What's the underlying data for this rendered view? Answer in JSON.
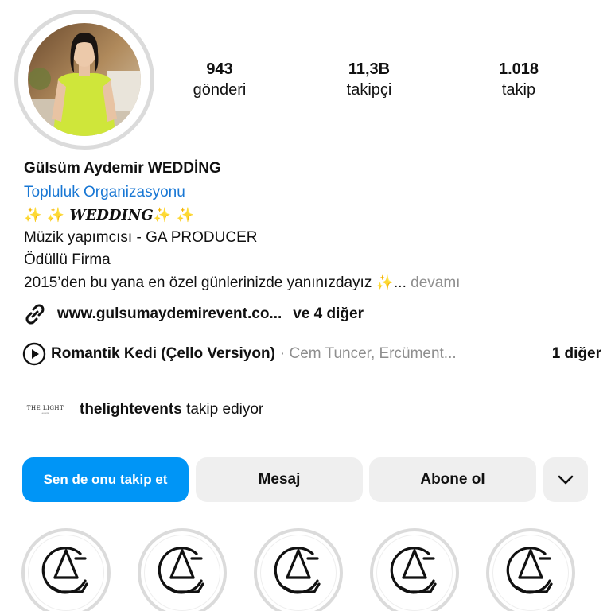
{
  "profile": {
    "avatar_icon": "profile-photo"
  },
  "stats": [
    {
      "value": "943",
      "label": "gönderi"
    },
    {
      "value": "11,3B",
      "label": "takipçi"
    },
    {
      "value": "1.018",
      "label": "takip"
    }
  ],
  "bio": {
    "name": "Gülsüm Aydemir WEDDİNG",
    "category": "Topluluk Organizasyonu",
    "wedding_sparkles_left": "✨ ✨ ",
    "wedding_text": "WEDDING",
    "wedding_sparkles_right": "✨ ✨",
    "line_music": "Müzik yapımcısı  - GA PRODUCER",
    "line_award": "Ödüllü  Firma",
    "line_since": "2015’den bu yana en özel günlerinizde yanınızdayız ",
    "since_sparkle": "✨",
    "ellipsis": "...",
    "more_label": "devamı"
  },
  "link": {
    "url": "www.gulsumaydemirevent.co...",
    "extra": "ve 4 diğer",
    "icon": "link-icon"
  },
  "music": {
    "title": "Romantik Kedi (Çello Versiyon)",
    "artist": "· Cem Tuncer, Ercüment...",
    "more": "1 diğer",
    "icon": "play-icon"
  },
  "followed_by": {
    "logo_text": "THE LIGHT",
    "logo_sub": "events",
    "username": "thelightevents",
    "suffix": " takip ediyor"
  },
  "buttons": {
    "follow": "Sen de onu takip et",
    "message": "Mesaj",
    "subscribe": "Abone ol",
    "more_icon": "chevron-down-icon"
  },
  "colors": {
    "accent": "#0095f6",
    "link_blue": "#1877d4",
    "button_gray": "#efefef",
    "muted": "#8e8e8e",
    "sparkle": "#f2c400"
  },
  "highlights": [
    {
      "icon": "ga-logo-icon"
    },
    {
      "icon": "ga-logo-icon"
    },
    {
      "icon": "ga-logo-icon"
    },
    {
      "icon": "ga-logo-icon"
    },
    {
      "icon": "ga-logo-icon"
    }
  ]
}
